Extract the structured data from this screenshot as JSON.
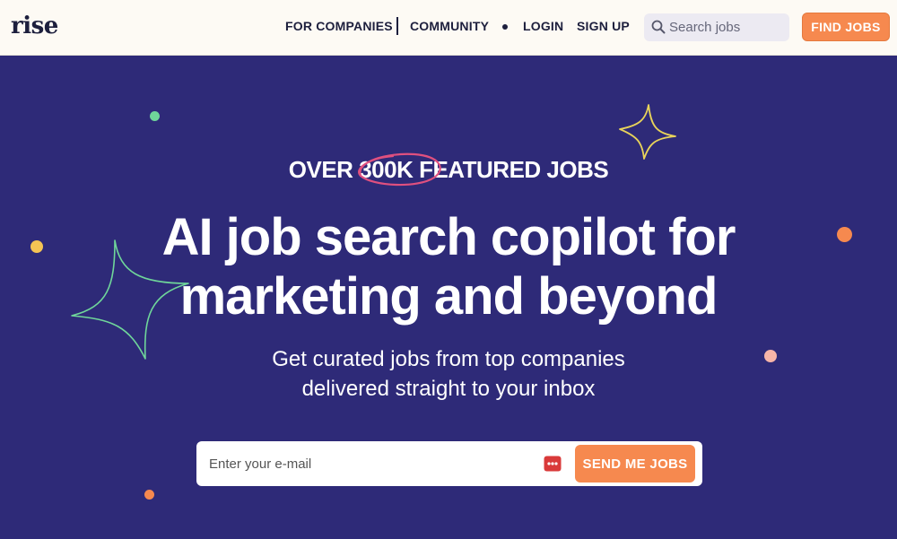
{
  "header": {
    "logo": "rise",
    "nav": {
      "for_companies": "FOR COMPANIES",
      "community": "COMMUNITY",
      "login": "LOGIN",
      "sign_up": "SIGN UP"
    },
    "search": {
      "placeholder": "Search jobs",
      "icon": "search-icon"
    },
    "find_jobs_label": "FIND JOBS"
  },
  "hero": {
    "kicker": {
      "prefix": "OVER ",
      "highlight": "300K",
      "suffix": " FEATURED JOBS"
    },
    "headline_line1": "AI job search copilot for",
    "headline_line2": "marketing and beyond",
    "sub_line1": "Get curated jobs from top companies",
    "sub_line2": "delivered straight to your inbox",
    "email_form": {
      "placeholder": "Enter your e-mail",
      "password_manager_icon": "password-manager-icon",
      "submit_label": "SEND ME JOBS"
    }
  },
  "colors": {
    "header_bg": "#fdfaf4",
    "hero_bg": "#2e2a78",
    "accent_orange": "#f6894f",
    "text_dark": "#1d1f3d",
    "highlight_circle": "#e0507f",
    "sparkle_yellow": "#e8d35a",
    "sparkle_green": "#6fd69a"
  }
}
